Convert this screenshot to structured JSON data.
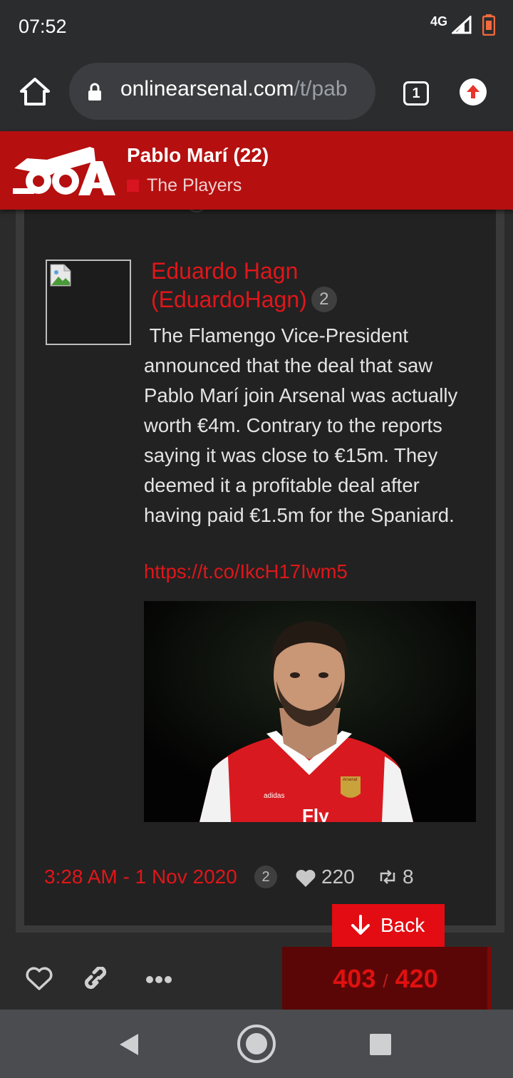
{
  "status_bar": {
    "time": "07:52",
    "network": "4G"
  },
  "browser": {
    "url_domain": "onlinearsenal.com",
    "url_path": "/t/pab",
    "tab_count": "1"
  },
  "header": {
    "logo_text": "OA",
    "title": "Pablo Marí (22)",
    "category": "The Players",
    "category_color": "#d7141f"
  },
  "post": {
    "author_name": "Eduardo Hagn",
    "author_handle": "(EduardoHagn)",
    "author_badge": "2",
    "text": " The Flamengo Vice-President announced that the deal that saw Pablo Marí join Arsenal was actually worth €4m. Contrary to the reports saying it was close to €15m. They deemed it a profitable deal after having paid €1.5m for the Spaniard.",
    "link": "https://t.co/IkcH17Iwm5",
    "image_jersey_text": "Fly",
    "image_brand_text": "adidas",
    "image_crest_text": "Arsenal",
    "timestamp": "3:28 AM - 1 Nov 2020",
    "timestamp_badge": "2",
    "likes": "220",
    "retweets": "8"
  },
  "back_button": {
    "label": "Back"
  },
  "progress": {
    "current": "403",
    "separator": "/",
    "total": "420"
  },
  "colors": {
    "accent": "#e0161a",
    "header_bg": "#b50f0f",
    "panel_bg": "#222222"
  }
}
